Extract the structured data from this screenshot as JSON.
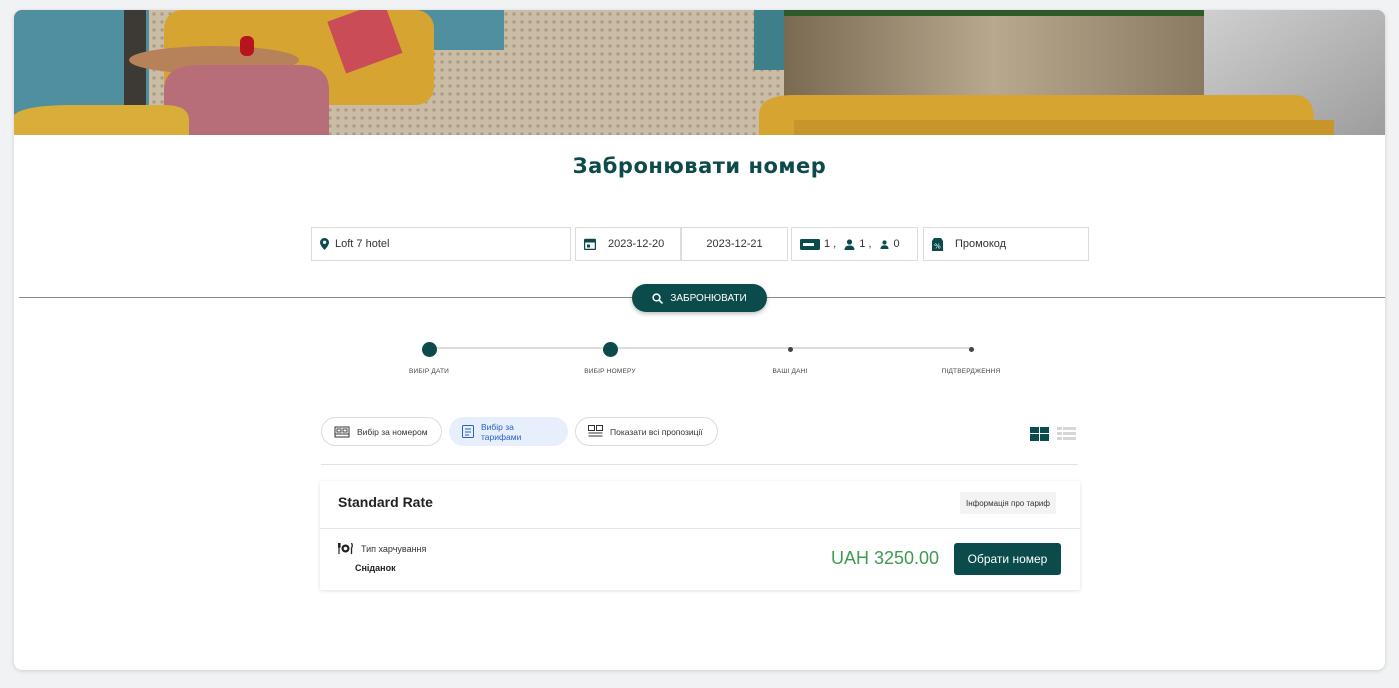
{
  "page": {
    "title": "Забронювати номер"
  },
  "search": {
    "hotel": "Loft 7 hotel",
    "checkin": "2023-12-20",
    "checkout": "2023-12-21",
    "rooms": "1 ,",
    "adults": "1 ,",
    "children": "0",
    "promo_placeholder": "Промокод",
    "button_label": "ЗАБРОНЮВАТИ"
  },
  "steps": [
    {
      "label": "ВИБІР ДАТИ",
      "state": "done"
    },
    {
      "label": "ВИБІР НОМЕРУ",
      "state": "current"
    },
    {
      "label": "ВАШІ ДАНІ",
      "state": "todo"
    },
    {
      "label": "ПІДТВЕРДЖЕННЯ",
      "state": "todo"
    }
  ],
  "filters": [
    {
      "label": "Вибір за номером",
      "icon": "bed-icon",
      "active": false
    },
    {
      "label": "Вибір за тарифами",
      "icon": "tariff-icon",
      "active": true
    },
    {
      "label": "Показати всі пропозиції",
      "icon": "offers-icon",
      "active": false
    }
  ],
  "view": {
    "grid_icon": "grid-view-icon",
    "list_icon": "list-view-icon",
    "active": "grid"
  },
  "rate": {
    "name": "Standard Rate",
    "info_button": "Інформація про тариф",
    "meal_label": "Тип харчування",
    "meal_value": "Сніданок",
    "price": "UAH 3250.00",
    "choose_button": "Обрати номер"
  },
  "colors": {
    "brand": "#0b4b4b",
    "price": "#3f9a52",
    "active_chip_bg": "#e7effc",
    "active_chip_text": "#2a62c4"
  }
}
